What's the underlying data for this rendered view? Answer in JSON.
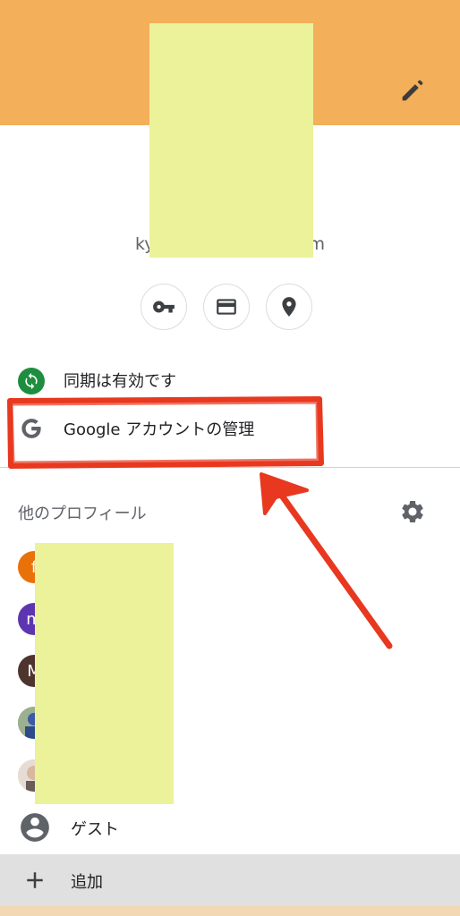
{
  "colors": {
    "header_bg": "#f3af59",
    "accent_red": "#e8381f",
    "sync_green": "#1e8e3e",
    "redaction": "#ecf299"
  },
  "account": {
    "email_visible_prefix": "ky",
    "email_visible_suffix": "m"
  },
  "quick_actions": [
    {
      "icon": "key-icon"
    },
    {
      "icon": "credit-card-icon"
    },
    {
      "icon": "location-pin-icon"
    }
  ],
  "sync": {
    "label": "同期は有効です",
    "icon": "sync-icon"
  },
  "manage_account": {
    "label": "Google アカウントの管理",
    "icon": "google-g-icon"
  },
  "other_profiles": {
    "title": "他のプロフィール",
    "items": [
      {
        "initial": "f",
        "color": "#e8710a"
      },
      {
        "initial": "m",
        "color": "#5e35b1"
      },
      {
        "initial": "M",
        "color": "#4e342e"
      },
      {
        "initial": "",
        "color": "#7da37a"
      },
      {
        "initial": "",
        "color": "#d9c6bb"
      }
    ]
  },
  "guest": {
    "label": "ゲスト"
  },
  "add": {
    "label": "追加"
  }
}
